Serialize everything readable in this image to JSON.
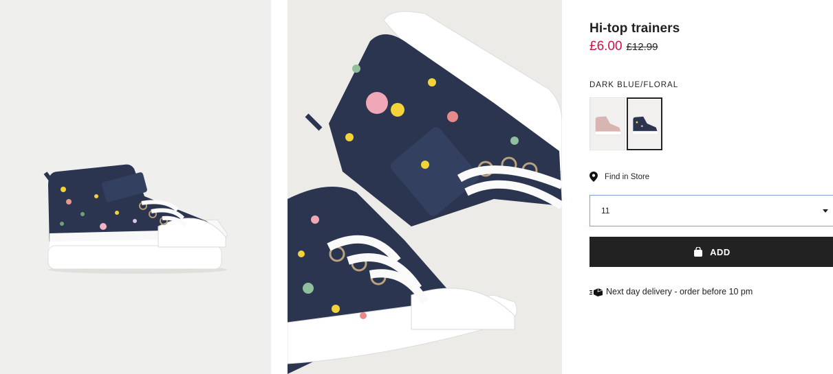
{
  "product": {
    "title": "Hi-top trainers",
    "price_sale": "£6.00",
    "price_original": "£12.99",
    "color_label": "DARK BLUE/FLORAL"
  },
  "swatches": [
    {
      "name": "pink",
      "selected": false
    },
    {
      "name": "dark-blue-floral",
      "selected": true
    }
  ],
  "find_store": {
    "label": "Find in Store",
    "icon": "location-pin-icon"
  },
  "size_select": {
    "value": "11"
  },
  "add_button": {
    "label": "ADD",
    "icon": "shopping-bag-icon"
  },
  "delivery": {
    "text": "Next day delivery - order before 10 pm",
    "icon": "delivery-truck-icon"
  },
  "colors": {
    "sale_price": "#d01345",
    "button_bg": "#222222",
    "select_border": "#7fa2d6",
    "shoe_navy": "#2b3550"
  }
}
